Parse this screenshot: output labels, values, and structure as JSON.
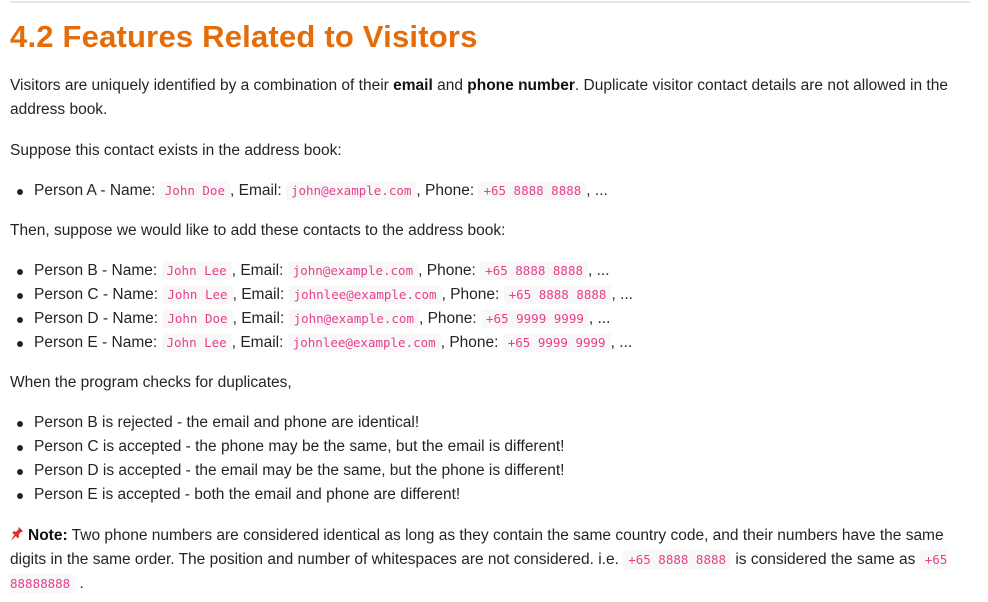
{
  "heading": "4.2 Features Related to Visitors",
  "intro": {
    "before": "Visitors are uniquely identified by a combination of their ",
    "bold1": "email",
    "mid": " and ",
    "bold2": "phone number",
    "after": ". Duplicate visitor contact details are not allowed in the address book."
  },
  "suppose": "Suppose this contact exists in the address book:",
  "existing": [
    {
      "label": "Person A - Name: ",
      "name": "John Doe",
      "email_label": ", Email: ",
      "email": "john@example.com",
      "phone_label": ", Phone: ",
      "phone": "+65 8888 8888",
      "tail": ", ..."
    }
  ],
  "then": "Then, suppose we would like to add these contacts to the address book:",
  "candidates": [
    {
      "label": "Person B - Name: ",
      "name": "John Lee",
      "email_label": ", Email: ",
      "email": "john@example.com",
      "phone_label": ", Phone: ",
      "phone": "+65 8888 8888",
      "tail": ", ..."
    },
    {
      "label": "Person C - Name: ",
      "name": "John Lee",
      "email_label": ", Email: ",
      "email": "johnlee@example.com",
      "phone_label": ", Phone: ",
      "phone": "+65 8888 8888",
      "tail": ", ..."
    },
    {
      "label": "Person D - Name: ",
      "name": "John Doe",
      "email_label": ", Email: ",
      "email": "john@example.com",
      "phone_label": ", Phone: ",
      "phone": "+65 9999 9999",
      "tail": ", ..."
    },
    {
      "label": "Person E - Name: ",
      "name": "John Lee",
      "email_label": ", Email: ",
      "email": "johnlee@example.com",
      "phone_label": ", Phone: ",
      "phone": "+65 9999 9999",
      "tail": ", ..."
    }
  ],
  "checks_intro": "When the program checks for duplicates,",
  "results": [
    "Person B is rejected - the email and phone are identical!",
    "Person C is accepted - the phone may be the same, but the email is different!",
    "Person D is accepted - the email may be the same, but the phone is different!",
    "Person E is accepted - both the email and phone are different!"
  ],
  "note": {
    "icon": "pushpin-icon",
    "label": "Note:",
    "text1": " Two phone numbers are considered identical as long as they contain the same country code, and their numbers have the same digits in the same order. The position and number of whitespaces are not considered. i.e. ",
    "code1": "+65 8888 8888",
    "text2": " is considered the same as ",
    "code2": "+65 88888888",
    "text3": " ."
  }
}
